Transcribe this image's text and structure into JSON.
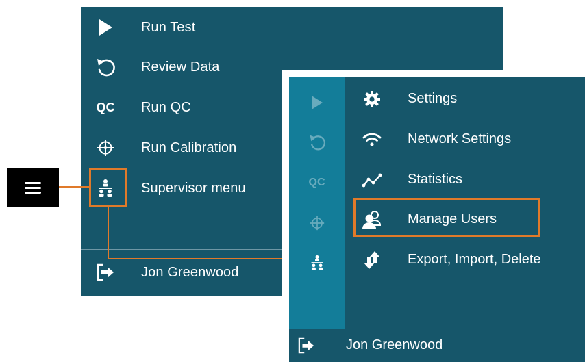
{
  "main_menu": {
    "items": [
      {
        "label": "Run Test",
        "icon": "play-icon"
      },
      {
        "label": "Review Data",
        "icon": "undo-arrow-icon"
      },
      {
        "label": "Run QC",
        "icon": "qc-icon",
        "icon_text": "QC"
      },
      {
        "label": "Run Calibration",
        "icon": "crosshair-icon"
      },
      {
        "label": "Supervisor menu",
        "icon": "org-chart-icon"
      }
    ],
    "footer": {
      "user_name": "Jon Greenwood",
      "icon": "sign-out-icon"
    }
  },
  "hamburger": {
    "icon": "hamburger-icon"
  },
  "supervisor_menu": {
    "rail_icons": [
      {
        "icon": "play-icon"
      },
      {
        "icon": "undo-arrow-icon"
      },
      {
        "icon": "qc-icon",
        "icon_text": "QC"
      },
      {
        "icon": "crosshair-icon"
      },
      {
        "icon": "org-chart-icon",
        "active": true
      }
    ],
    "items": [
      {
        "label": "Settings",
        "icon": "gear-icon"
      },
      {
        "label": "Network Settings",
        "icon": "wifi-icon"
      },
      {
        "label": "Statistics",
        "icon": "line-chart-icon"
      },
      {
        "label": "Manage Users",
        "icon": "users-icon",
        "highlighted": true
      },
      {
        "label": "Export, Import, Delete",
        "icon": "export-import-icon"
      }
    ],
    "footer": {
      "user_name": "Jon Greenwood",
      "icon": "sign-out-icon"
    }
  },
  "colors": {
    "panel": "#16566a",
    "rail": "#137d99",
    "highlight": "#e07a2a",
    "text": "#ffffff"
  }
}
